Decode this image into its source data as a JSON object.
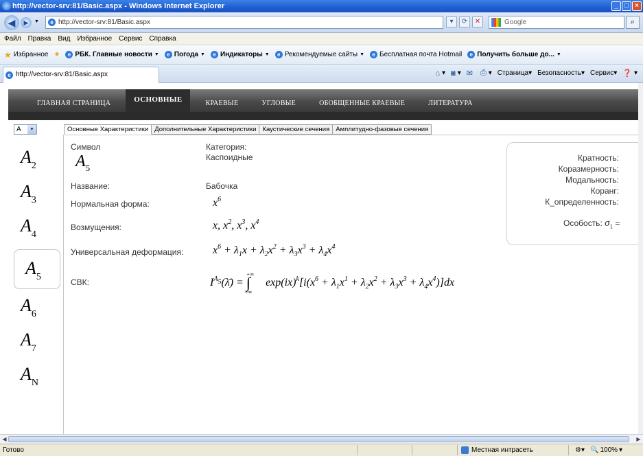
{
  "browser": {
    "window_title": "http://vector-srv:81/Basic.aspx - Windows Internet Explorer",
    "address": "http://vector-srv:81/Basic.aspx",
    "search_placeholder": "Google",
    "menu": [
      "Файл",
      "Правка",
      "Вид",
      "Избранное",
      "Сервис",
      "Справка"
    ],
    "favorites_label": "Избранное",
    "favorites": [
      {
        "label": "РБК. Главные новости",
        "bold": true,
        "dropdown": true
      },
      {
        "label": "Погода",
        "bold": true,
        "dropdown": true
      },
      {
        "label": "Индикаторы",
        "bold": true,
        "dropdown": true
      },
      {
        "label": "Рекомендуемые сайты",
        "bold": false,
        "dropdown": true
      },
      {
        "label": "Бесплатная почта Hotmail",
        "bold": false,
        "dropdown": false
      },
      {
        "label": "Получить больше до...",
        "bold": true,
        "dropdown": true
      }
    ],
    "tab_title": "http://vector-srv:81/Basic.aspx",
    "commands": [
      "Страница",
      "Безопасность",
      "Сервис"
    ],
    "status": "Готово",
    "zone": "Местная интрасеть",
    "zoom": "100%"
  },
  "site": {
    "nav": [
      {
        "label": "ГЛАВНАЯ СТРАНИЦА",
        "active": false
      },
      {
        "label": "ОСНОВНЫЕ",
        "active": true
      },
      {
        "label": "КРАЕВЫЕ",
        "active": false
      },
      {
        "label": "УГЛОВЫЕ",
        "active": false
      },
      {
        "label": "ОБОБЩЕННЫЕ КРАЕВЫЕ",
        "active": false
      },
      {
        "label": "ЛИТЕРАТУРА",
        "active": false
      }
    ],
    "series_select": "A",
    "tabs": [
      "Основные Характеристики",
      "Дополнительные Характеристики",
      "Каустические сечения",
      "Амплитудно-фазовые сечения"
    ],
    "singularities": [
      {
        "letter": "A",
        "index": "2",
        "selected": false
      },
      {
        "letter": "A",
        "index": "3",
        "selected": false
      },
      {
        "letter": "A",
        "index": "4",
        "selected": false
      },
      {
        "letter": "A",
        "index": "5",
        "selected": true
      },
      {
        "letter": "A",
        "index": "6",
        "selected": false
      },
      {
        "letter": "A",
        "index": "7",
        "selected": false
      },
      {
        "letter": "A",
        "index": "N",
        "selected": false
      }
    ]
  },
  "details": {
    "symbol_label": "Символ",
    "symbol_letter": "A",
    "symbol_index": "5",
    "category_label": "Категория:",
    "category_value": "Каспоидные",
    "name_label": "Название:",
    "name_value": "Бабочка",
    "normal_form_label": "Нормальная форма:",
    "perturbations_label": "Возмущения:",
    "universal_label": "Универсальная деформация:",
    "svk_label": "СВК:"
  },
  "properties": {
    "multiplicity": "Кратность:",
    "codimension": "Коразмерность:",
    "modality": "Модальность:",
    "corank": "Коранг:",
    "k_determinacy": "К_определенность:",
    "singularity": "Особость:",
    "sigma": "σ",
    "sigma_index": "1",
    "sigma_tail": "="
  }
}
